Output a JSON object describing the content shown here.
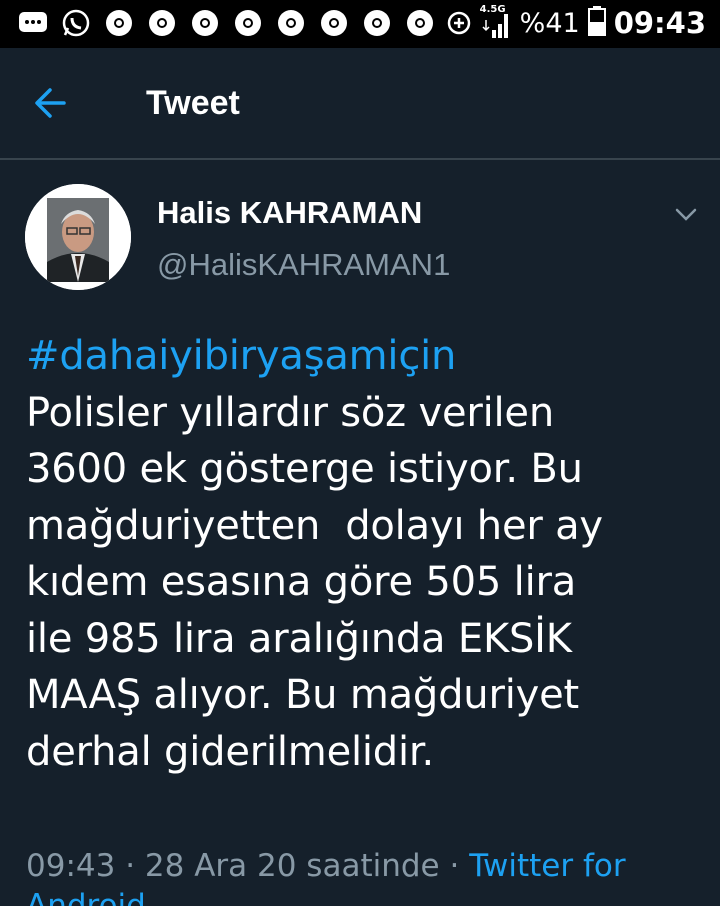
{
  "status_bar": {
    "network_label": "4.5G",
    "battery": "%41",
    "time": "09:43",
    "notification_icons": [
      "message-icon",
      "whatsapp-icon",
      "chrome-icon",
      "chrome-icon",
      "chrome-icon",
      "chrome-icon",
      "chrome-icon",
      "chrome-icon",
      "chrome-icon",
      "chrome-icon",
      "data-saver-icon"
    ]
  },
  "header": {
    "title": "Tweet"
  },
  "tweet": {
    "display_name": "Halis KAHRAMAN",
    "handle": "@HalisKAHRAMAN1",
    "hashtag": "#dahaiyibiryaşamiçin",
    "lines": [
      "Polisler yıllardır söz verilen",
      "3600 ek gösterge istiyor. Bu",
      "mağduriyetten  dolayı her ay",
      "kıdem esasına göre 505 lira",
      "ile 985 lira aralığında EKSİK",
      "MAAŞ alıyor. Bu mağduriyet",
      "derhal giderilmelidir."
    ],
    "timestamp": "09:43 · 28 Ara 20 saatinde · ",
    "source": "Twitter for",
    "source_cont": "Android"
  },
  "colors": {
    "background": "#15202b",
    "accent": "#1da1f2",
    "secondary_text": "#8899a6",
    "divider": "#38444d"
  }
}
